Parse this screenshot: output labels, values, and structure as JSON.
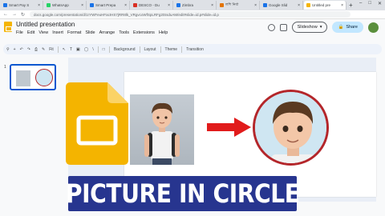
{
  "browser": {
    "tabs": [
      {
        "label": "Smart Pay S",
        "color": "#1a73e8"
      },
      {
        "label": "WhatsApp",
        "color": "#25d366"
      },
      {
        "label": "Smart Prepa",
        "color": "#1a73e8"
      },
      {
        "label": "DESCO - Du",
        "color": "#d93025"
      },
      {
        "label": "Zimbra",
        "color": "#1a73e8"
      },
      {
        "label": "লশি নির্বা",
        "color": "#e37400"
      },
      {
        "label": "Google Slid",
        "color": "#1a73e8"
      },
      {
        "label": "Untitled pre",
        "color": "#f4b400",
        "active": true
      }
    ],
    "new_tab": "+",
    "url": "docs.google.com/presentation/d/1rYWFeuHFacIHS7jRR8lk_VRgvcoWfSpLRFg2tSsduAM/edit#slide=id.p#slide=id.p"
  },
  "doc": {
    "title": "Untitled presentation",
    "menu": [
      "File",
      "Edit",
      "View",
      "Insert",
      "Format",
      "Slide",
      "Arrange",
      "Tools",
      "Extensions",
      "Help"
    ],
    "slideshow_label": "Slideshow",
    "share_label": "Share"
  },
  "toolbar": {
    "zoom": "Fit",
    "background": "Background",
    "layout": "Layout",
    "theme": "Theme",
    "transition": "Transition"
  },
  "filmstrip": {
    "slide_number": "1"
  },
  "banner": {
    "text": "PICTURE IN CIRCLE"
  }
}
